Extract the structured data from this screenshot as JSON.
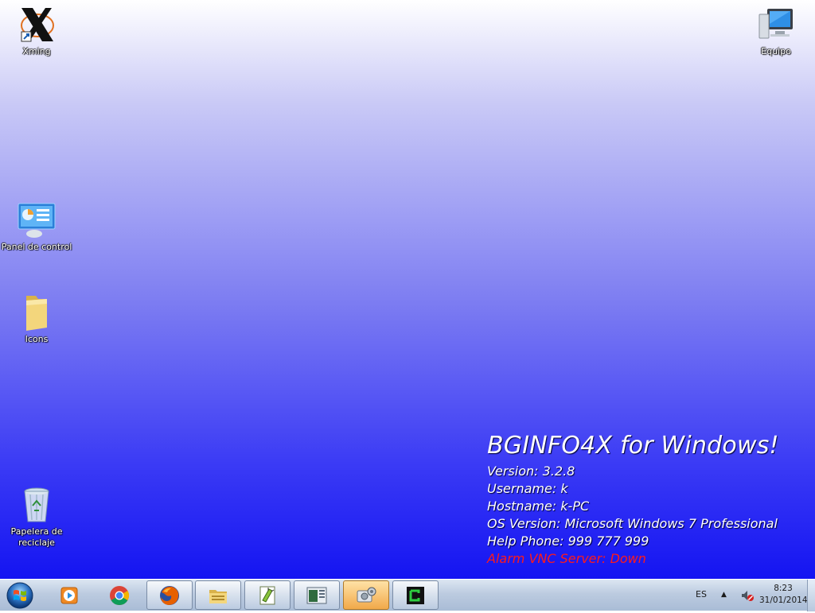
{
  "desktop": {
    "icons": [
      {
        "label": "Xming",
        "icon": "xming-icon"
      },
      {
        "label": "Equipo",
        "icon": "computer-icon"
      },
      {
        "label": "Panel de control",
        "icon": "control-panel-icon"
      },
      {
        "label": "Icons",
        "icon": "folder-icon"
      },
      {
        "label": "Papelera de reciclaje",
        "icon": "recycle-bin-icon"
      }
    ]
  },
  "bginfo": {
    "title": "BGINFO4X for Windows!",
    "lines": [
      "Version: 3.2.8",
      "Username: k",
      "Hostname: k-PC",
      "OS Version: Microsoft Windows 7 Professional",
      "Help Phone: 999 777 999"
    ],
    "alarm": "Alarm VNC Server: Down",
    "alarm_color": "#ff1a1a"
  },
  "taskbar": {
    "start_icon": "windows-start-orb",
    "buttons": [
      {
        "icon": "media-player-icon",
        "state": "pinned"
      },
      {
        "icon": "chrome-icon",
        "state": "pinned"
      },
      {
        "icon": "firefox-icon",
        "state": "open"
      },
      {
        "icon": "explorer-icon",
        "state": "open"
      },
      {
        "icon": "notepad-plus-plus-icon",
        "state": "open"
      },
      {
        "icon": "bginfo-editor-icon",
        "state": "open"
      },
      {
        "icon": "settings-tool-icon",
        "state": "active"
      },
      {
        "icon": "terminal-icon",
        "state": "open"
      }
    ],
    "tray": {
      "language": "ES",
      "arrow": "▲",
      "volume_icon": "volume-muted-icon",
      "time": "8:23",
      "date": "31/01/2014"
    }
  }
}
